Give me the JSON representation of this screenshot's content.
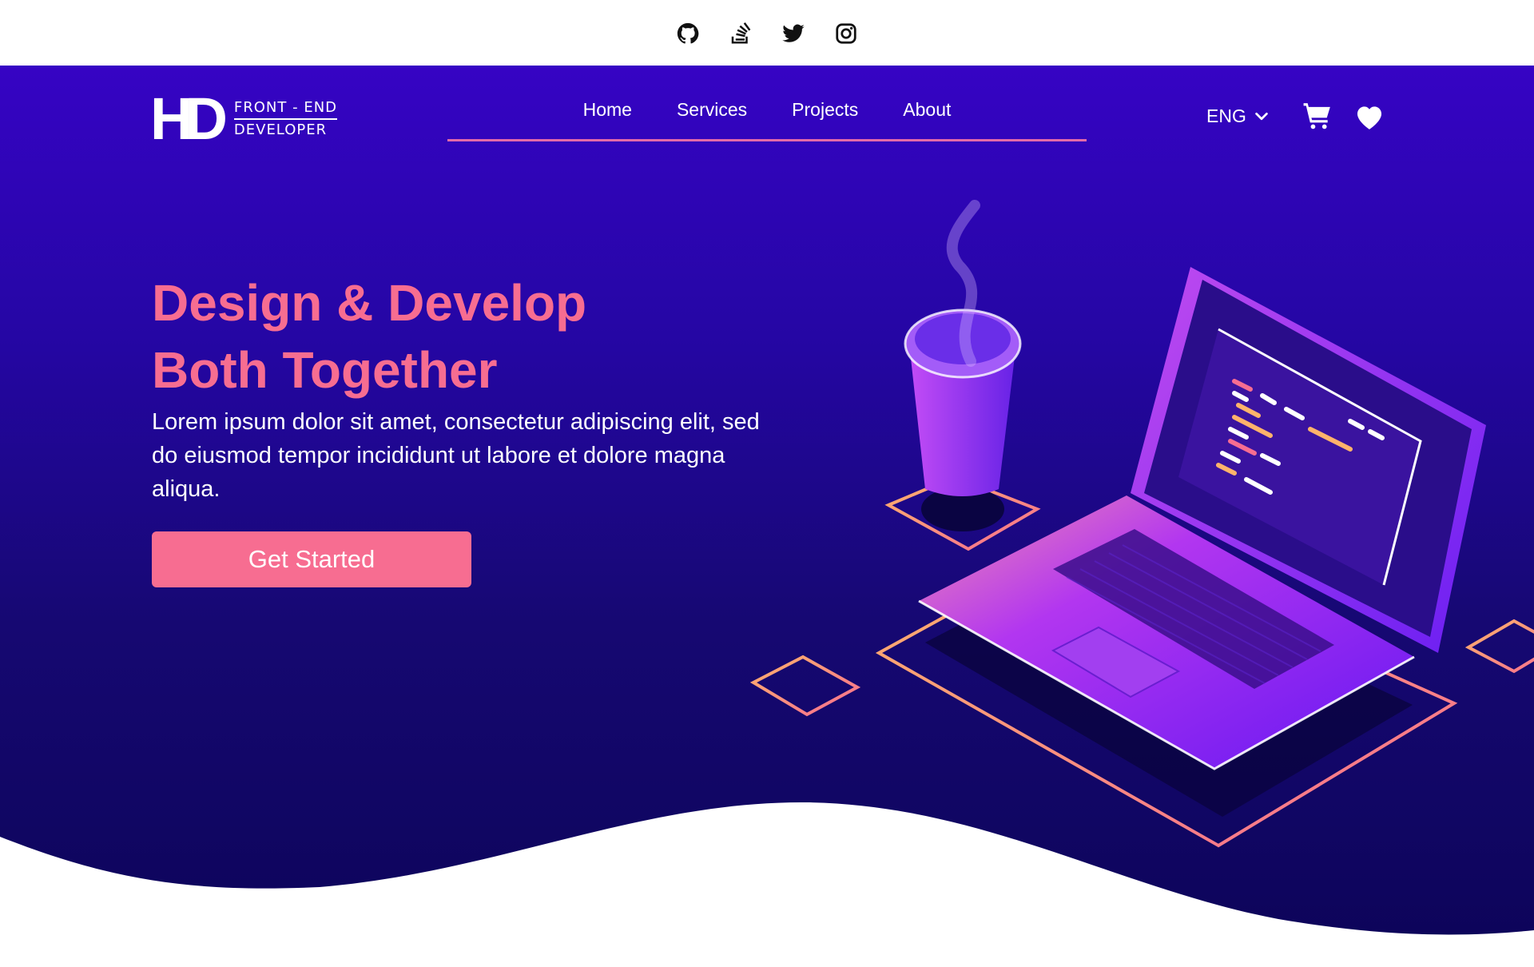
{
  "social": [
    {
      "name": "github-icon"
    },
    {
      "name": "stackoverflow-icon"
    },
    {
      "name": "twitter-icon"
    },
    {
      "name": "instagram-icon"
    }
  ],
  "brand": {
    "mark": "HD",
    "line1": "FRONT - END",
    "line2": "DEVELOPER"
  },
  "nav": {
    "items": [
      {
        "label": "Home"
      },
      {
        "label": "Services"
      },
      {
        "label": "Projects"
      },
      {
        "label": "About"
      }
    ]
  },
  "lang": {
    "label": "ENG"
  },
  "hero": {
    "title_line1": "Design & Develop",
    "title_line2": "Both Together",
    "lead": "Lorem ipsum dolor sit amet, consectetur adipiscing elit, sed do eiusmod tempor incididunt ut labore et dolore magna aliqua.",
    "cta": "Get Started"
  },
  "colors": {
    "accent": "#f76d91",
    "hero_top": "#3604c4",
    "hero_bottom": "#0c0458",
    "nav_underline": "#e36aa9"
  }
}
